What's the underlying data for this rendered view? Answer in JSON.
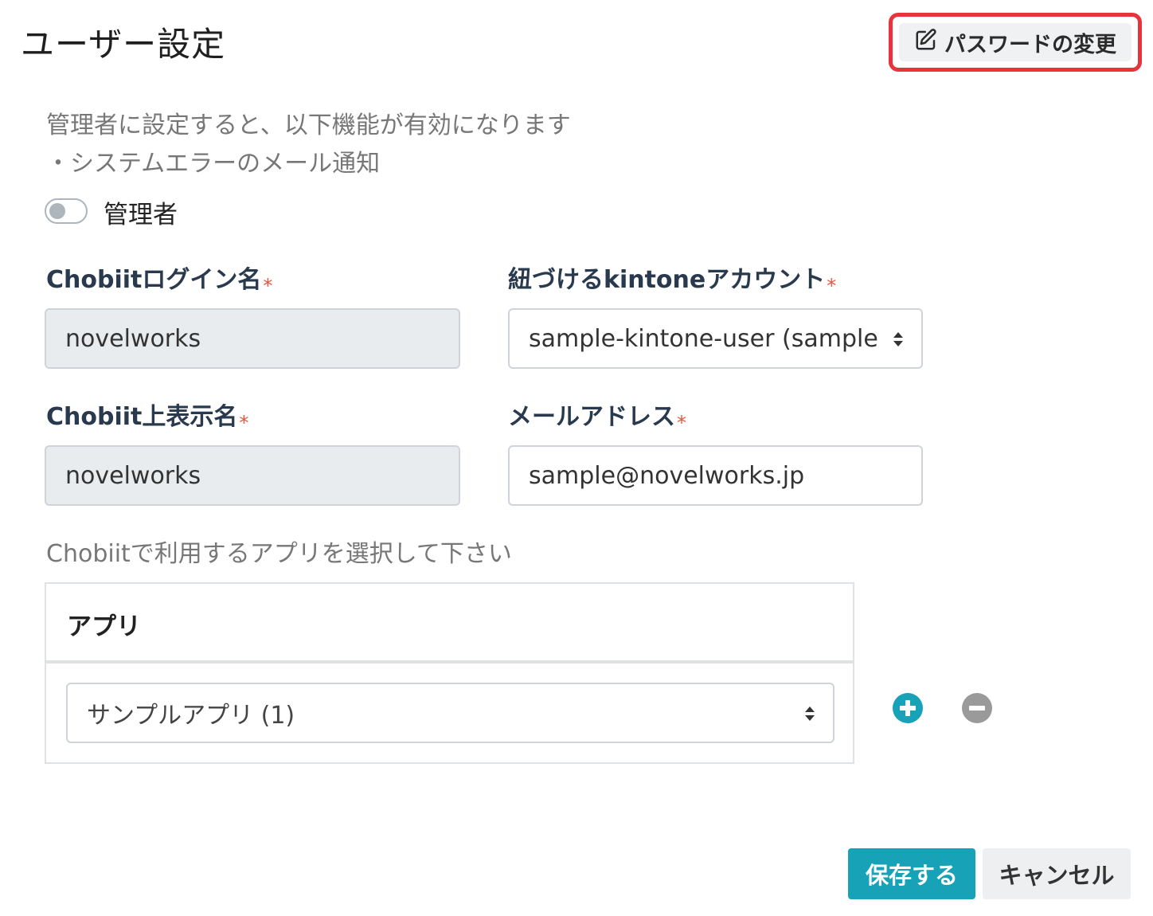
{
  "header": {
    "title": "ユーザー設定",
    "password_button_label": "パスワードの変更"
  },
  "description": {
    "line1": "管理者に設定すると、以下機能が有効になります",
    "line2": "・システムエラーのメール通知"
  },
  "admin_toggle": {
    "label": "管理者",
    "checked": false
  },
  "fields": {
    "login_name": {
      "label": "Chobiitログイン名",
      "required_mark": "*",
      "value": "novelworks"
    },
    "kintone_account": {
      "label": "紐づけるkintoneアカウント",
      "required_mark": "*",
      "value": "sample-kintone-user (sample-"
    },
    "display_name": {
      "label": "Chobiit上表示名",
      "required_mark": "*",
      "value": "novelworks"
    },
    "email": {
      "label": "メールアドレス",
      "required_mark": "*",
      "value": "sample@novelworks.jp"
    }
  },
  "apps": {
    "hint": "Chobiitで利用するアプリを選択して下さい",
    "column_header": "アプリ",
    "rows": [
      {
        "selected": "サンプルアプリ (1)"
      }
    ]
  },
  "actions": {
    "save_label": "保存する",
    "cancel_label": "キャンセル"
  },
  "colors": {
    "accent": "#17a2b8",
    "required": "#e8553f",
    "highlight_border": "#e8333c",
    "remove_icon": "#9a9a9a"
  }
}
